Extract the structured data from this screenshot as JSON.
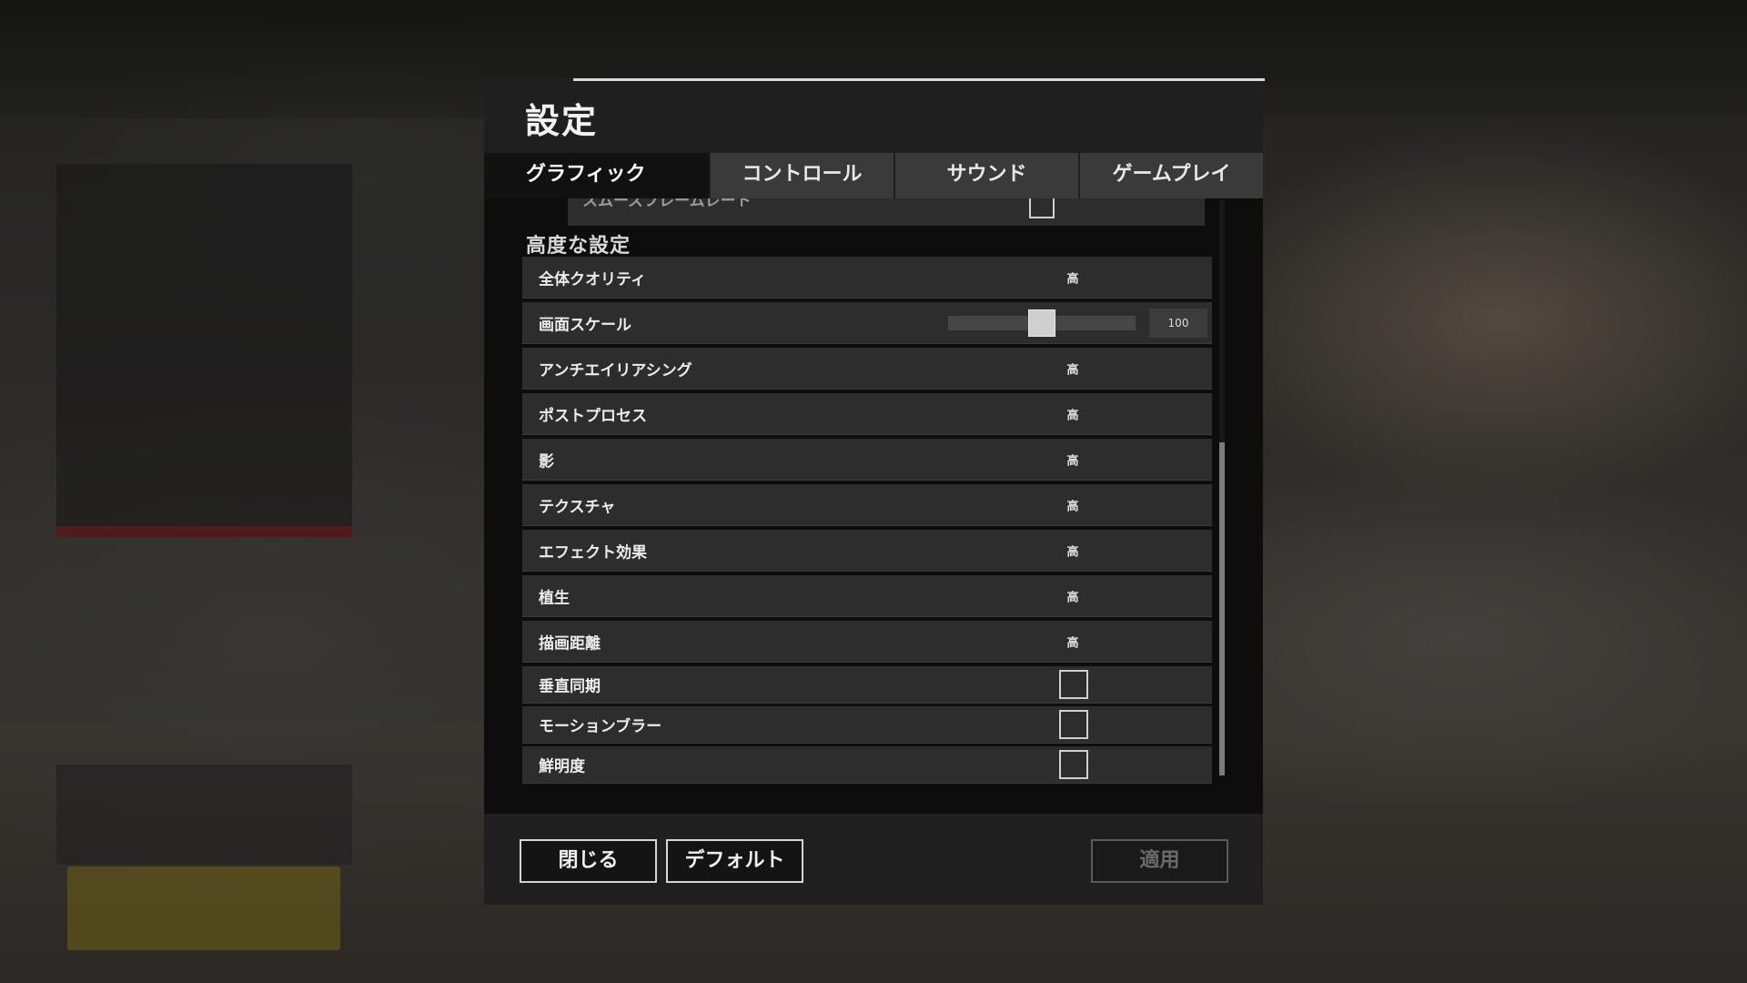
{
  "dialog": {
    "title": "設定"
  },
  "tabs": [
    {
      "label": "グラフィック",
      "active": true
    },
    {
      "label": "コントロール",
      "active": false
    },
    {
      "label": "サウンド",
      "active": false
    },
    {
      "label": "ゲームプレイ",
      "active": false
    }
  ],
  "partial_row": {
    "label": "スムーズフレームレート",
    "checked": false
  },
  "section": {
    "heading": "高度な設定"
  },
  "settings": [
    {
      "label": "全体クオリティ",
      "value": "高"
    },
    {
      "label": "画面スケール",
      "slider_value": "100",
      "slider_fraction": 0.5
    },
    {
      "label": "アンチエイリアシング",
      "value": "高"
    },
    {
      "label": "ポストプロセス",
      "value": "高"
    },
    {
      "label": "影",
      "value": "高"
    },
    {
      "label": "テクスチャ",
      "value": "高"
    },
    {
      "label": "エフェクト効果",
      "value": "高"
    },
    {
      "label": "植生",
      "value": "高"
    },
    {
      "label": "描画距離",
      "value": "高"
    },
    {
      "label": "垂直同期",
      "checked": false
    },
    {
      "label": "モーションブラー",
      "checked": false
    },
    {
      "label": "鮮明度",
      "checked": false
    }
  ],
  "footer": {
    "close_label": "閉じる",
    "default_label": "デフォルト",
    "apply_label": "適用",
    "apply_enabled": false
  }
}
